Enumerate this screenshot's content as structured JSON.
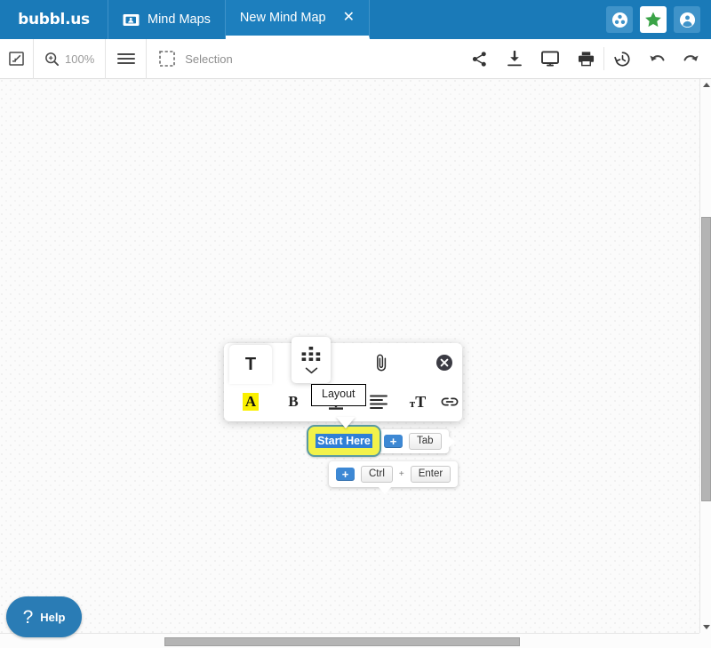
{
  "app": {
    "brand": "bubbl.us",
    "colors": {
      "header_blue": "#1a7ab8",
      "accent_blue": "#3f93c9",
      "star_green": "#3aa347",
      "bubble_yellow": "#f2f24a",
      "bubble_border": "#5a9aa0",
      "selection_blue": "#2f7fd6",
      "highlight_yellow": "#faf000",
      "help_blue": "#2a7cb5"
    }
  },
  "header": {
    "tabs": [
      {
        "label": "Mind Maps",
        "icon": "folder-contact-icon",
        "active": false
      },
      {
        "label": "New Mind Map",
        "icon": "",
        "active": true,
        "close": "✕"
      }
    ],
    "actions": [
      {
        "name": "collaborate-button",
        "icon": "collaborate-icon"
      },
      {
        "name": "favorite-button",
        "icon": "star-icon"
      },
      {
        "name": "account-button",
        "icon": "user-icon"
      }
    ]
  },
  "toolbar": {
    "fit_screen": "fit-to-screen-icon",
    "zoom_icon": "zoom-in-icon",
    "zoom_level": "100%",
    "menu_icon": "hamburger-menu-icon",
    "selection_icon": "selection-marquee-icon",
    "selection_label": "Selection",
    "right_actions": [
      {
        "name": "share-button",
        "icon": "share-icon"
      },
      {
        "name": "download-button",
        "icon": "download-icon"
      },
      {
        "name": "presentation-button",
        "icon": "monitor-icon"
      },
      {
        "name": "print-button",
        "icon": "print-icon"
      },
      {
        "name": "history-button",
        "icon": "history-clock-icon"
      },
      {
        "name": "undo-button",
        "icon": "undo-arrow-icon"
      },
      {
        "name": "redo-button",
        "icon": "redo-arrow-icon"
      }
    ]
  },
  "format_popup": {
    "tab_text": "T",
    "layout_button": "layout-grid-icon",
    "attach_button": "paperclip-icon",
    "close_button": "close-circle-icon",
    "row2": [
      {
        "name": "text-color-button",
        "label": "A"
      },
      {
        "name": "bold-button",
        "label": "B"
      },
      {
        "name": "fill-color-button",
        "label": ""
      },
      {
        "name": "align-button",
        "label": ""
      },
      {
        "name": "font-size-button",
        "label": "тT"
      },
      {
        "name": "link-button",
        "label": ""
      }
    ]
  },
  "tooltip": {
    "layout": "Layout"
  },
  "canvas": {
    "bubble": {
      "text": "Start Here",
      "selected": true
    },
    "hints": [
      {
        "name": "hint-add-sibling",
        "plus": "+",
        "keys": [
          "Tab"
        ],
        "separator": ""
      },
      {
        "name": "hint-add-child",
        "plus": "+",
        "keys": [
          "Ctrl",
          "Enter"
        ],
        "separator": "+"
      }
    ]
  },
  "help": {
    "icon": "question-mark-icon",
    "label": "Help"
  },
  "scrollbars": {
    "vertical": {
      "up": "scroll-up-arrow-icon",
      "down": "scroll-down-arrow-icon"
    },
    "horizontal": {}
  }
}
